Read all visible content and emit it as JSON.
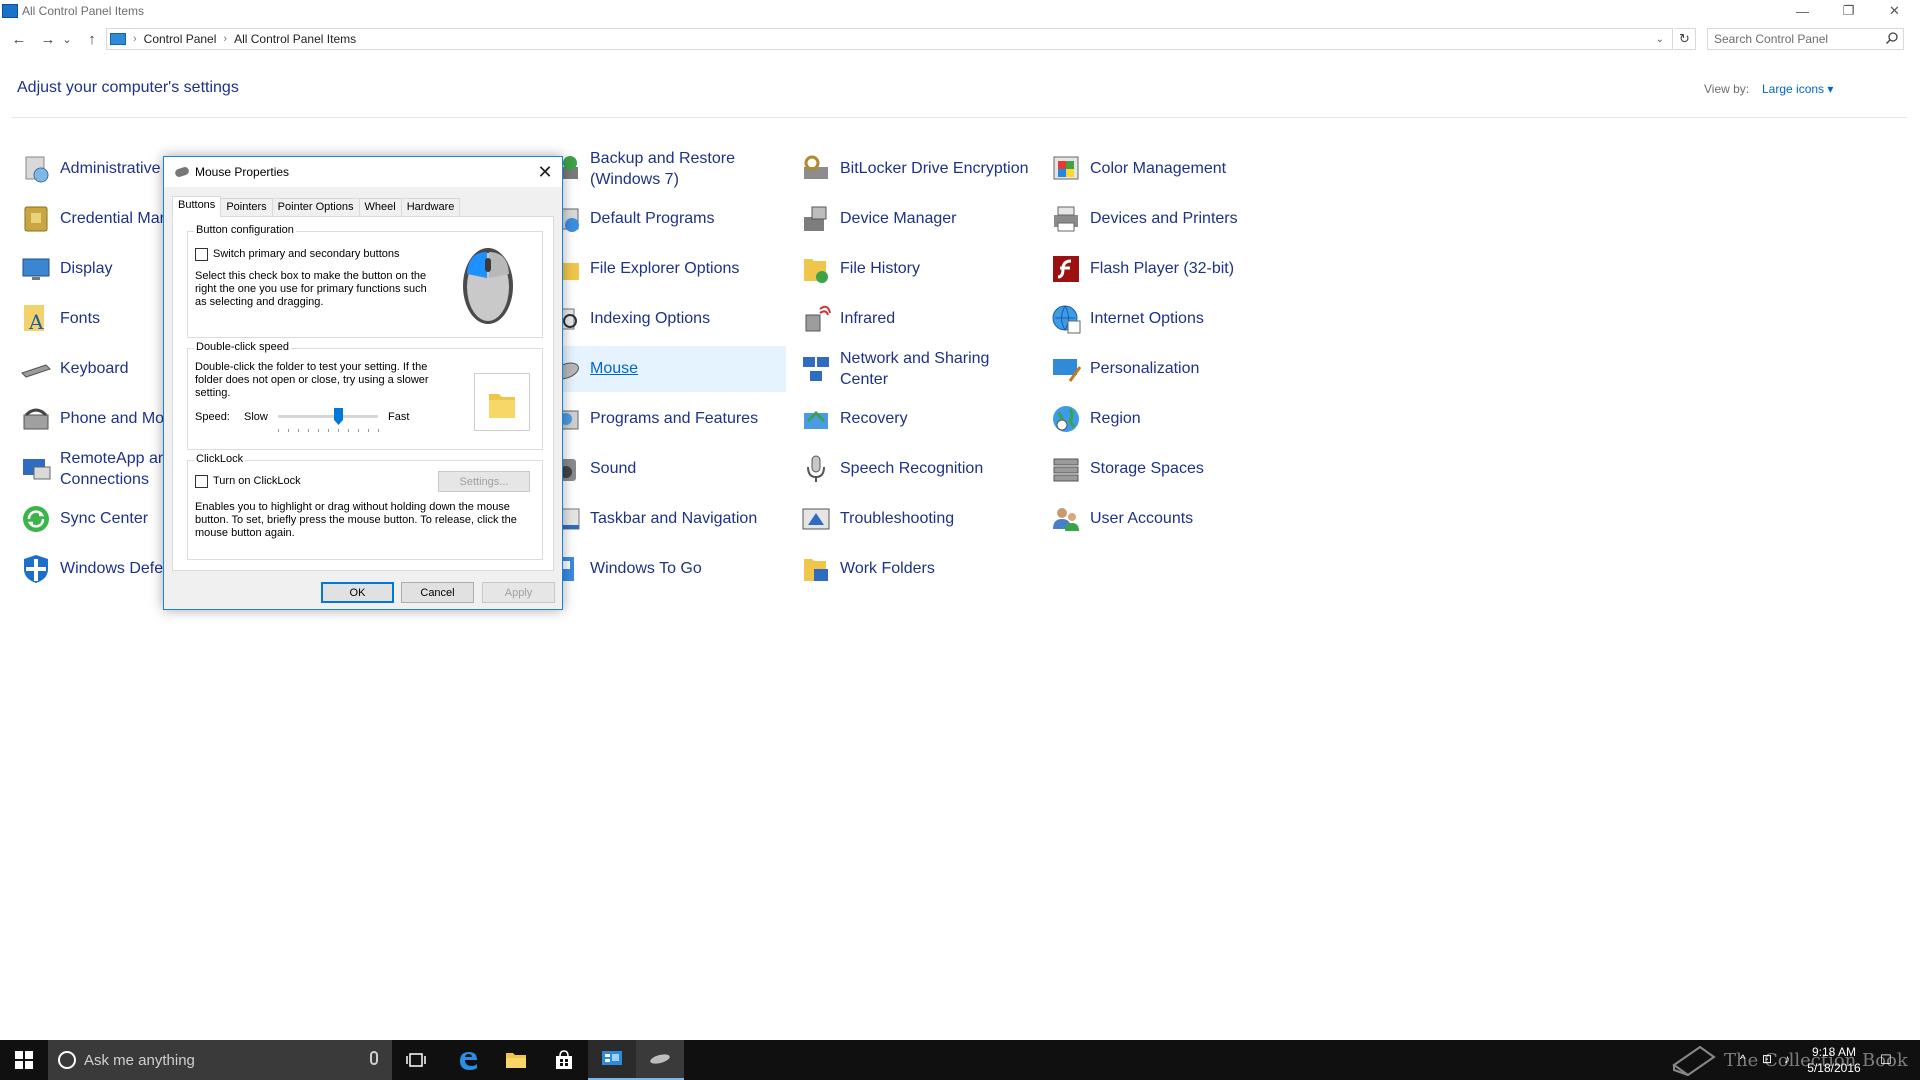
{
  "window": {
    "title": "All Control Panel Items",
    "minimize_glyph": "—",
    "restore_glyph": "❐",
    "close_glyph": "✕"
  },
  "nav": {
    "back_glyph": "←",
    "forward_glyph": "→",
    "recent_glyph": "⌄",
    "up_glyph": "↑"
  },
  "address": {
    "crumbs": [
      "Control Panel",
      "All Control Panel Items"
    ],
    "separator": "›",
    "dropdown_glyph": "⌄",
    "refresh_glyph": "↻"
  },
  "search": {
    "placeholder": "Search Control Panel"
  },
  "header": {
    "title": "Adjust your computer's settings",
    "view_by_label": "View by:",
    "view_by_value": "Large icons ▾"
  },
  "columns": [
    [
      {
        "label": "Administrative",
        "icon": "admin-tools-icon"
      },
      {
        "label": "Credential Mar",
        "icon": "credential-manager-icon"
      },
      {
        "label": "Display",
        "icon": "display-icon"
      },
      {
        "label": "Fonts",
        "icon": "fonts-icon"
      },
      {
        "label": "Keyboard",
        "icon": "keyboard-icon"
      },
      {
        "label": "Phone and Mo",
        "icon": "phone-modem-icon"
      },
      {
        "label": "RemoteApp an",
        "label2": "Connections",
        "icon": "remoteapp-icon"
      },
      {
        "label": "Sync Center",
        "icon": "sync-center-icon"
      },
      {
        "label": "Windows Defe",
        "icon": "windows-defender-icon"
      }
    ],
    [
      {
        "label": "Backup and Restore",
        "label2": "(Windows 7)",
        "icon": "backup-icon"
      },
      {
        "label": "Default Programs",
        "icon": "default-programs-icon"
      },
      {
        "label": "File Explorer Options",
        "icon": "folder-options-icon"
      },
      {
        "label": "Indexing Options",
        "icon": "indexing-icon"
      },
      {
        "label": "Mouse",
        "icon": "mouse-icon",
        "selected": true
      },
      {
        "label": "Programs and Features",
        "icon": "programs-icon"
      },
      {
        "label": "Sound",
        "icon": "sound-icon"
      },
      {
        "label": "Taskbar and Navigation",
        "icon": "taskbar-icon"
      },
      {
        "label": "Windows To Go",
        "icon": "windows-to-go-icon"
      }
    ],
    [
      {
        "label": "BitLocker Drive Encryption",
        "icon": "bitlocker-icon"
      },
      {
        "label": "Device Manager",
        "icon": "device-manager-icon"
      },
      {
        "label": "File History",
        "icon": "file-history-icon"
      },
      {
        "label": "Infrared",
        "icon": "infrared-icon"
      },
      {
        "label": "Network and Sharing",
        "label2": "Center",
        "icon": "network-icon"
      },
      {
        "label": "Recovery",
        "icon": "recovery-icon"
      },
      {
        "label": "Speech Recognition",
        "icon": "microphone-icon"
      },
      {
        "label": "Troubleshooting",
        "icon": "troubleshooting-icon"
      },
      {
        "label": "Work Folders",
        "icon": "work-folders-icon"
      }
    ],
    [
      {
        "label": "Color Management",
        "icon": "color-management-icon"
      },
      {
        "label": "Devices and Printers",
        "icon": "printer-icon"
      },
      {
        "label": "Flash Player (32-bit)",
        "icon": "flash-icon"
      },
      {
        "label": "Internet Options",
        "icon": "internet-options-icon"
      },
      {
        "label": "Personalization",
        "icon": "personalization-icon"
      },
      {
        "label": "Region",
        "icon": "region-icon"
      },
      {
        "label": "Storage Spaces",
        "icon": "storage-spaces-icon"
      },
      {
        "label": "User Accounts",
        "icon": "user-accounts-icon"
      }
    ]
  ],
  "dialog": {
    "title": "Mouse Properties",
    "close_glyph": "✕",
    "tabs": [
      "Buttons",
      "Pointers",
      "Pointer Options",
      "Wheel",
      "Hardware"
    ],
    "button_config": {
      "legend": "Button configuration",
      "checkbox_label": "Switch primary and secondary buttons",
      "checked": false,
      "description": [
        "Select this check box to make the button on the",
        "right the one you use for primary functions such",
        "as selecting and dragging."
      ]
    },
    "double_click": {
      "legend": "Double-click speed",
      "description": [
        "Double-click the folder to test your setting. If the",
        "folder does not open or close, try using a slower",
        "setting."
      ],
      "speed_label": "Speed:",
      "slow_label": "Slow",
      "fast_label": "Fast",
      "speed_fraction": 0.6
    },
    "clicklock": {
      "legend": "ClickLock",
      "checkbox_label": "Turn on ClickLock",
      "checked": false,
      "settings_button": "Settings...",
      "description": [
        "Enables you to highlight or drag without holding down the mouse",
        "button. To set, briefly press the mouse button. To release, click the",
        "mouse button again."
      ]
    },
    "buttons": {
      "ok": "OK",
      "cancel": "Cancel",
      "apply": "Apply"
    }
  },
  "taskbar": {
    "search_placeholder": "Ask me anything",
    "time": "9:18 AM",
    "date": "5/18/2016",
    "watermark": "The Collection Book",
    "tray_glyphs": [
      "^",
      "⊡",
      "♪",
      "☐"
    ]
  },
  "colors": {
    "link_blue": "#1e3287",
    "accent": "#0078d7",
    "taskbar": "#101010",
    "selected_bg": "#e5f3ff"
  }
}
